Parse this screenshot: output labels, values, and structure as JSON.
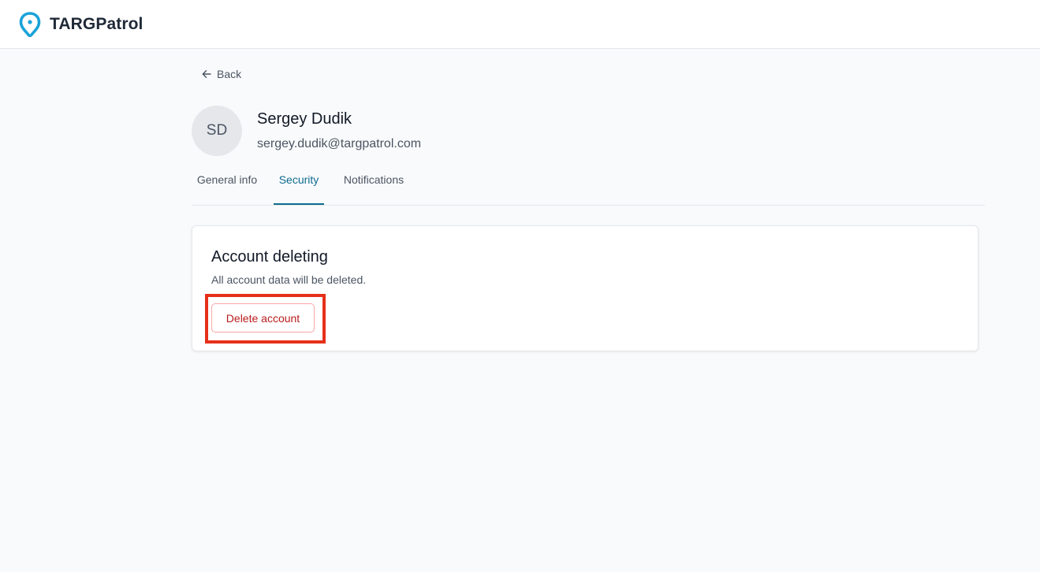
{
  "app": {
    "name": "TARGPatrol",
    "logo_icon": "map-pin-icon",
    "brand_color": "#1aa3d8"
  },
  "nav": {
    "back_label": "Back",
    "back_icon": "arrow-left-icon"
  },
  "profile": {
    "initials": "SD",
    "name": "Sergey Dudik",
    "email": "sergey.dudik@targpatrol.com"
  },
  "tabs": [
    {
      "label": "General info",
      "active": false
    },
    {
      "label": "Security",
      "active": true
    },
    {
      "label": "Notifications",
      "active": false
    }
  ],
  "account_deleting": {
    "title": "Account deleting",
    "description": "All account data will be deleted.",
    "button_label": "Delete account"
  },
  "colors": {
    "accent": "#0e6b8f",
    "danger": "#b91c1c",
    "highlight": "#e53019"
  }
}
